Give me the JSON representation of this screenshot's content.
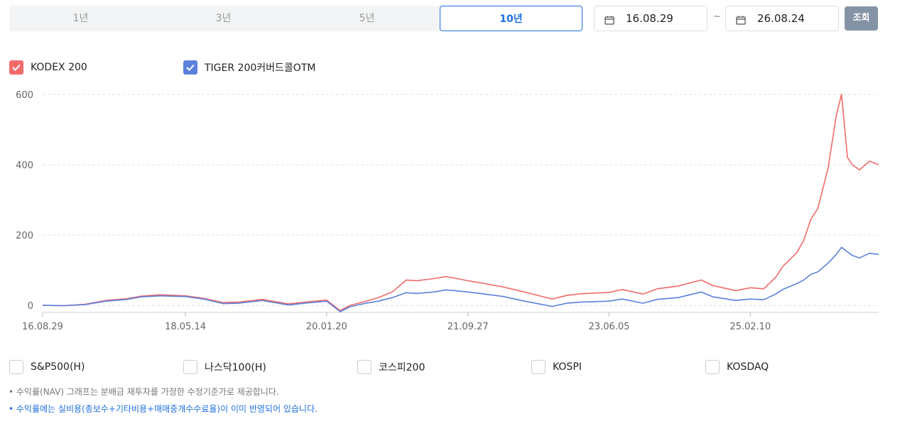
{
  "period_tabs": [
    {
      "label": "1년",
      "active": false
    },
    {
      "label": "3년",
      "active": false
    },
    {
      "label": "5년",
      "active": false
    },
    {
      "label": "10년",
      "active": true
    }
  ],
  "date_range": {
    "start": "16.08.29",
    "separator": "~",
    "end": "26.08.24"
  },
  "search_button": "조회",
  "legend": [
    {
      "label": "KODEX 200",
      "color": "#f26b6b",
      "checked": true
    },
    {
      "label": "TIGER 200커버드콜OTM",
      "color": "#5b80dd",
      "checked": true
    }
  ],
  "benchmarks": [
    {
      "label": "S&P500(H)",
      "checked": false
    },
    {
      "label": "나스닥100(H)",
      "checked": false
    },
    {
      "label": "코스피200",
      "checked": false
    },
    {
      "label": "KOSPI",
      "checked": false
    },
    {
      "label": "KOSDAQ",
      "checked": false
    }
  ],
  "notes": [
    "• 수익률(NAV) 그래프는 분배금 재투자를 가정한 수정기준가로 제공합니다.",
    "• 수익률에는 실비용(총보수+기타비용+매매중개수수료율)이 이미 반영되어 있습니다."
  ],
  "chart_data": {
    "type": "line",
    "x_start": "2016-08-29",
    "x_end": "2026-08-24",
    "x_tick_labels": [
      "16.08.29",
      "18.05.14",
      "20.01.20",
      "21.09.27",
      "23.06.05",
      "25.02.10"
    ],
    "y_ticks": [
      0,
      200,
      400,
      600
    ],
    "ylim": [
      -20,
      610
    ],
    "grid": true,
    "series": [
      {
        "name": "KODEX 200",
        "color": "#f26b6b",
        "points": [
          [
            "2016-08-29",
            0
          ],
          [
            "2016-12-01",
            -1
          ],
          [
            "2017-03-01",
            3
          ],
          [
            "2017-06-01",
            14
          ],
          [
            "2017-09-01",
            19
          ],
          [
            "2017-11-01",
            26
          ],
          [
            "2018-01-25",
            30
          ],
          [
            "2018-05-14",
            27
          ],
          [
            "2018-08-01",
            20
          ],
          [
            "2018-10-25",
            8
          ],
          [
            "2019-01-01",
            9
          ],
          [
            "2019-04-15",
            17
          ],
          [
            "2019-08-06",
            4
          ],
          [
            "2019-11-01",
            10
          ],
          [
            "2020-01-20",
            15
          ],
          [
            "2020-03-19",
            -15
          ],
          [
            "2020-05-01",
            0
          ],
          [
            "2020-07-01",
            10
          ],
          [
            "2020-09-01",
            22
          ],
          [
            "2020-11-01",
            38
          ],
          [
            "2021-01-01",
            72
          ],
          [
            "2021-02-15",
            70
          ],
          [
            "2021-05-01",
            76
          ],
          [
            "2021-06-24",
            82
          ],
          [
            "2021-09-27",
            70
          ],
          [
            "2021-12-01",
            63
          ],
          [
            "2022-03-01",
            52
          ],
          [
            "2022-06-01",
            38
          ],
          [
            "2022-09-30",
            18
          ],
          [
            "2022-12-01",
            28
          ],
          [
            "2023-02-01",
            33
          ],
          [
            "2023-06-05",
            37
          ],
          [
            "2023-08-01",
            45
          ],
          [
            "2023-10-31",
            32
          ],
          [
            "2024-01-01",
            47
          ],
          [
            "2024-04-01",
            55
          ],
          [
            "2024-07-11",
            72
          ],
          [
            "2024-09-01",
            56
          ],
          [
            "2024-12-09",
            42
          ],
          [
            "2025-02-10",
            50
          ],
          [
            "2025-04-09",
            47
          ],
          [
            "2025-06-01",
            80
          ],
          [
            "2025-07-01",
            110
          ],
          [
            "2025-09-01",
            150
          ],
          [
            "2025-10-01",
            185
          ],
          [
            "2025-11-01",
            245
          ],
          [
            "2025-12-01",
            275
          ],
          [
            "2026-01-15",
            390
          ],
          [
            "2026-02-20",
            540
          ],
          [
            "2026-03-15",
            600
          ],
          [
            "2026-04-10",
            420
          ],
          [
            "2026-05-01",
            400
          ],
          [
            "2026-06-01",
            385
          ],
          [
            "2026-07-15",
            410
          ],
          [
            "2026-08-24",
            400
          ]
        ]
      },
      {
        "name": "TIGER 200커버드콜OTM",
        "color": "#5b80dd",
        "points": [
          [
            "2016-08-29",
            0
          ],
          [
            "2016-12-01",
            -1
          ],
          [
            "2017-03-01",
            2
          ],
          [
            "2017-06-01",
            12
          ],
          [
            "2017-09-01",
            17
          ],
          [
            "2017-11-01",
            24
          ],
          [
            "2018-01-25",
            27
          ],
          [
            "2018-05-14",
            25
          ],
          [
            "2018-08-01",
            18
          ],
          [
            "2018-10-25",
            5
          ],
          [
            "2019-01-01",
            6
          ],
          [
            "2019-04-15",
            14
          ],
          [
            "2019-08-06",
            1
          ],
          [
            "2019-11-01",
            7
          ],
          [
            "2020-01-20",
            12
          ],
          [
            "2020-03-19",
            -18
          ],
          [
            "2020-05-01",
            -4
          ],
          [
            "2020-07-01",
            5
          ],
          [
            "2020-09-01",
            12
          ],
          [
            "2020-11-01",
            22
          ],
          [
            "2021-01-01",
            36
          ],
          [
            "2021-02-15",
            34
          ],
          [
            "2021-05-01",
            38
          ],
          [
            "2021-06-24",
            44
          ],
          [
            "2021-09-27",
            38
          ],
          [
            "2021-12-01",
            33
          ],
          [
            "2022-03-01",
            25
          ],
          [
            "2022-06-01",
            12
          ],
          [
            "2022-09-30",
            -3
          ],
          [
            "2022-12-01",
            6
          ],
          [
            "2023-02-01",
            9
          ],
          [
            "2023-06-05",
            12
          ],
          [
            "2023-08-01",
            18
          ],
          [
            "2023-10-31",
            6
          ],
          [
            "2024-01-01",
            17
          ],
          [
            "2024-04-01",
            22
          ],
          [
            "2024-07-11",
            38
          ],
          [
            "2024-09-01",
            24
          ],
          [
            "2024-12-09",
            14
          ],
          [
            "2025-02-10",
            18
          ],
          [
            "2025-04-09",
            16
          ],
          [
            "2025-06-01",
            32
          ],
          [
            "2025-07-01",
            45
          ],
          [
            "2025-09-01",
            62
          ],
          [
            "2025-10-01",
            72
          ],
          [
            "2025-11-01",
            88
          ],
          [
            "2025-12-01",
            95
          ],
          [
            "2026-01-15",
            120
          ],
          [
            "2026-02-20",
            145
          ],
          [
            "2026-03-15",
            165
          ],
          [
            "2026-04-10",
            152
          ],
          [
            "2026-05-01",
            142
          ],
          [
            "2026-06-01",
            135
          ],
          [
            "2026-07-15",
            148
          ],
          [
            "2026-08-24",
            145
          ]
        ]
      }
    ]
  }
}
